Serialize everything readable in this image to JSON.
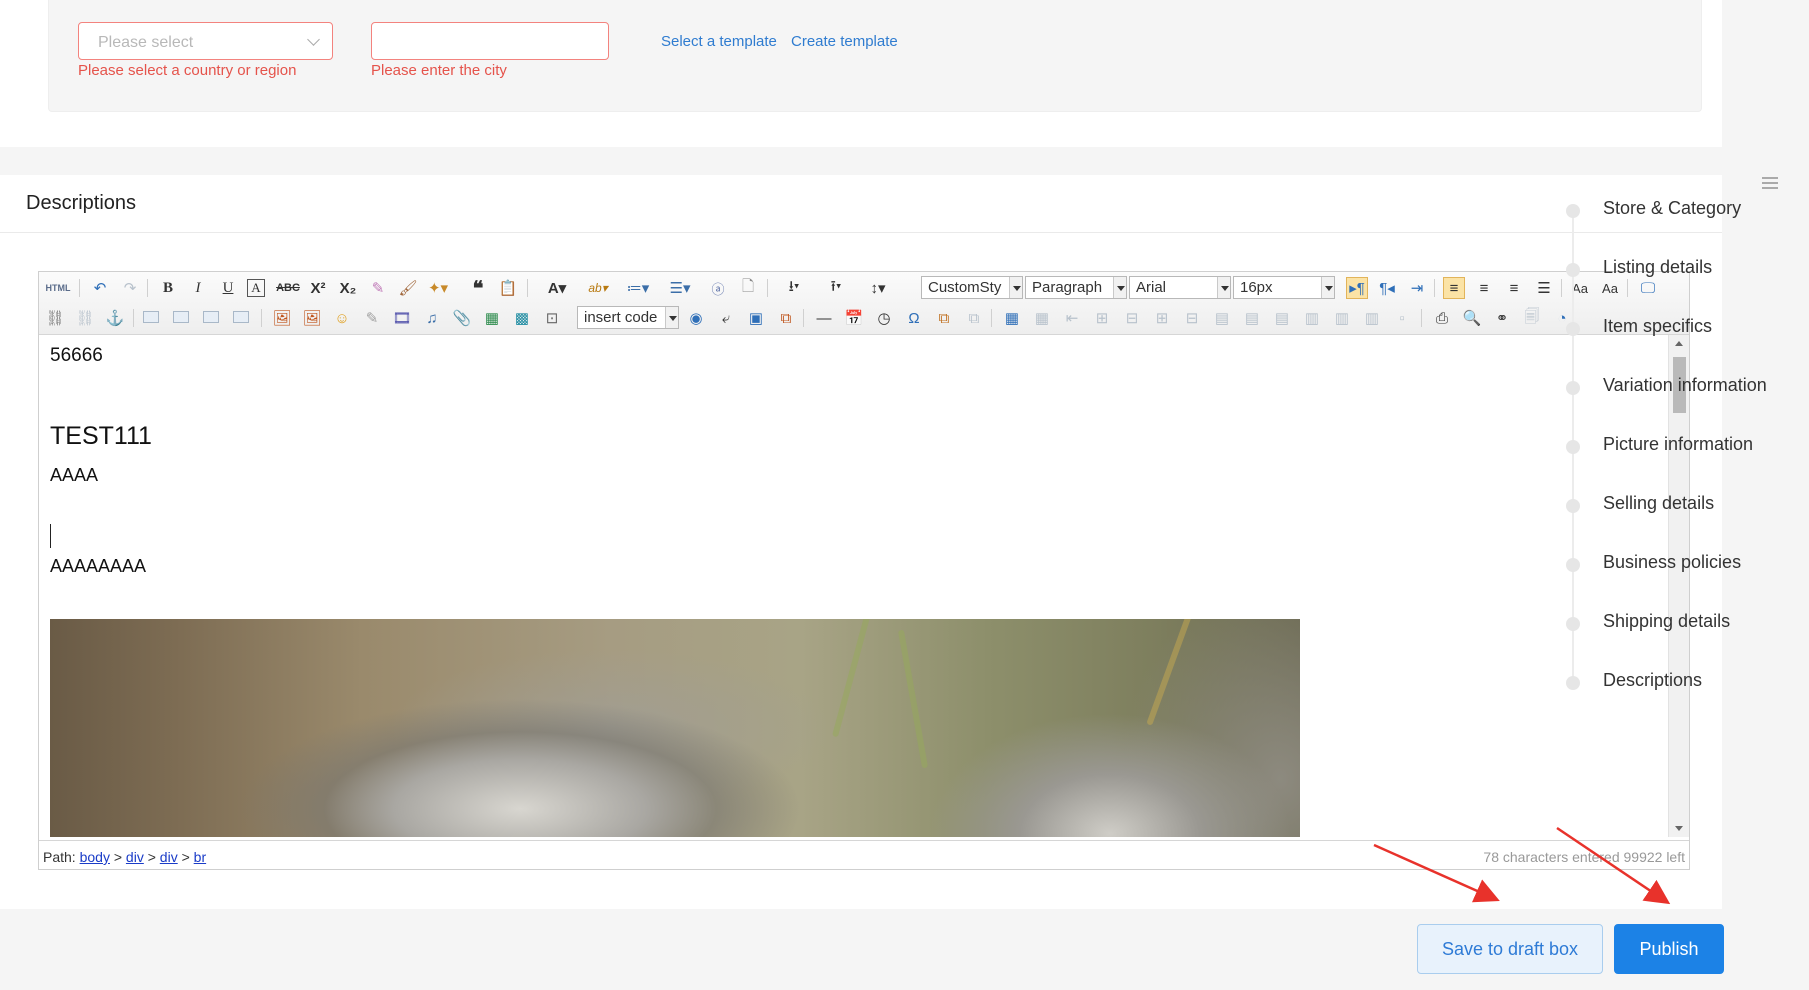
{
  "location": {
    "country_placeholder": "Please select",
    "country_error": "Please select a country or region",
    "city_value": "",
    "city_error": "Please enter the city",
    "select_template": "Select a template",
    "create_template": "Create template"
  },
  "descriptions": {
    "title": "Descriptions"
  },
  "editor": {
    "toolbar": {
      "html_label": "HTML",
      "custom_style": "CustomSty",
      "paragraph": "Paragraph",
      "font": "Arial",
      "size": "16px",
      "insert_code": "insert code"
    },
    "content": {
      "line1": "56666",
      "line2": "TEST111",
      "line3": "AAAA",
      "line4": "AAAAAAAA"
    },
    "status": {
      "path_label": "Path:",
      "path_items": [
        "body",
        "div",
        "div",
        "br"
      ],
      "path_sep": ">",
      "char_count": "78 characters entered 99922 left"
    }
  },
  "anchor_nav": {
    "items": [
      "Store & Category",
      "Listing details",
      "Item specifics",
      "Variation information",
      "Picture information",
      "Selling details",
      "Business policies",
      "Shipping details",
      "Descriptions"
    ]
  },
  "footer": {
    "save_draft": "Save to draft box",
    "publish": "Publish"
  },
  "colors": {
    "primary": "#1c82e6",
    "error": "#e5534b",
    "link": "#2f7cd0",
    "annotation_arrow": "#e8322b"
  }
}
